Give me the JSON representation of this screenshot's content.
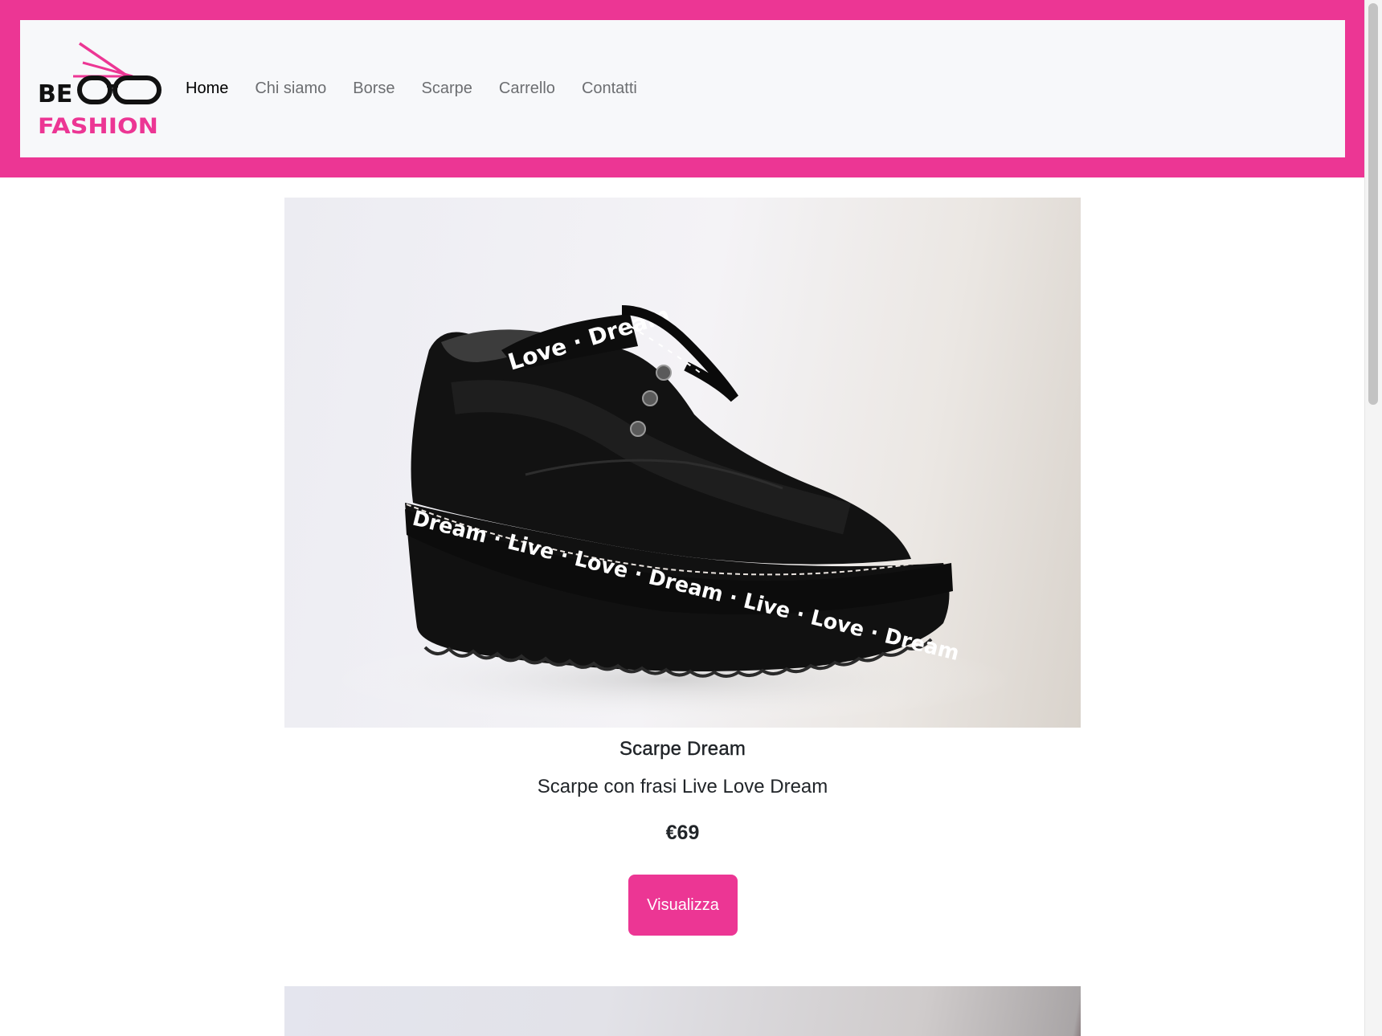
{
  "brand": {
    "logo_line1": "BE",
    "logo_line2": "FASHION",
    "accent_color": "#ec3694"
  },
  "nav": {
    "items": [
      {
        "label": "Home",
        "active": true
      },
      {
        "label": "Chi siamo",
        "active": false
      },
      {
        "label": "Borse",
        "active": false
      },
      {
        "label": "Scarpe",
        "active": false
      },
      {
        "label": "Carrello",
        "active": false
      },
      {
        "label": "Contatti",
        "active": false
      }
    ]
  },
  "products": [
    {
      "name": "Scarpe Dream",
      "description": "Scarpe con frasi Live Love Dream",
      "price": "€69",
      "button_label": "Visualizza",
      "image": {
        "subject": "black suede platform shoe",
        "band_text": "Dream · Live · Love · Dream · Live · Love · Dream",
        "lace_text": "Love · Dream"
      }
    }
  ]
}
